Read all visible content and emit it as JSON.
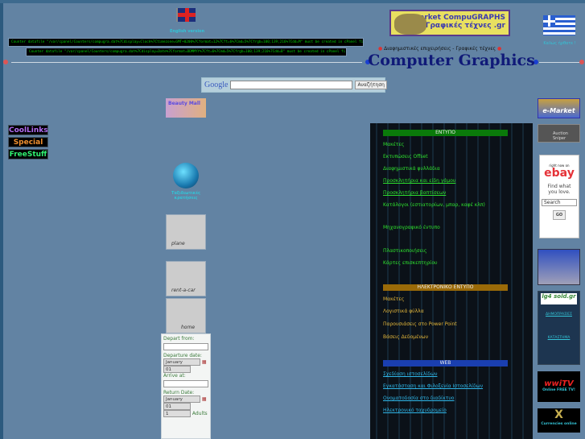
{
  "header": {
    "english_version": "English version",
    "welcome": "Καλώς ήρθατε !",
    "logo_text": "e-market CompuGRAPHS Γραφικές τέχνες .gr",
    "subtitle": "Διαφημιστικές επιχειρήσεις - Γραφικές τέχνες",
    "title": "Computer Graphics"
  },
  "counters": [
    "Counter datafile \"/var/cpanel/Counters/compugra.dat%7Cdisplay=Clock%7Ctimezone=GMT+0200%7Cformat=12%7Cft=6%7Cmd=5%7Cfrgb=100;139;216%7Cdd=M\" must be created in cPanel first!",
    "Counter datafile \"/var/cpanel/Counters/compugra.dat%7Cdisplay=Date%7Cformat=DDMMYY%7Cft=6%7Cmd=5%7Cfrgb=100;139;216%7Cdd=B\" must be created in cPanel first!"
  ],
  "search": {
    "logo": "Google",
    "button": "Αναζήτηση",
    "value": ""
  },
  "left_banners": [
    "CoolLinks",
    "Special",
    "FreeStuff"
  ],
  "middle": {
    "beauty_banner": "Beauty Mall",
    "travel_label": "Ταξιδιωτικές κρατήσεις",
    "plane": "plane",
    "rent": "rent-a-car",
    "home": "home"
  },
  "flight_form": {
    "depart_from": "Depart from:",
    "departure_date": "Departure date:",
    "month": "January",
    "day": "01",
    "arrive_at": "Arrive at:",
    "return_date": "Return Date:",
    "adults_value": "1",
    "adults": "Adults"
  },
  "sections": [
    {
      "title": "ΕΝΤΥΠΟ",
      "color": "#0a7a0a",
      "items": [
        "Μακέτες",
        "Εκτυπώσεις Offset",
        "Διαφημιστικά φυλλάδια",
        "Προσκλητήρια και είδη γάμου",
        "Προσκλητήρια βαπτίσεων",
        "Κατάλογοι (εστιατορίων, μπαρ, καφέ κλπ)",
        "Μηχανογραφικό έντυπο",
        "Πλαστικοποιήσεις",
        "Κάρτες επισκεπτηρίου"
      ]
    },
    {
      "title": "ΗΛΕΚΤΡΟΝΙΚΟ ΕΝΤΥΠΟ",
      "color": "#9a6a08",
      "items": [
        "Μακέτες",
        "Λογιστικά φύλλα",
        "Παρουσιάσεις στο Power Point",
        "Βάσεις Δεδομένων"
      ]
    },
    {
      "title": "WEB",
      "color": "#1a3fb0",
      "items": [
        "Σχεδίαση ιστοσελίδων",
        "Εγκατάσταση και Φιλοξενία Ιστοσελίδων",
        "Ονοματοδοσία στο διαδίκτυο",
        "Ηλεκτρονικό ταχυδρομείο"
      ]
    }
  ],
  "right": {
    "emarket": "e-Market",
    "auction": "Auction Sniper",
    "ebay_top": "right now on",
    "ebay_logo": "ebay",
    "ebay_text": "Find what you love.",
    "ebay_search": "Search",
    "ebay_go": "GO",
    "gr_logo": "lg4 sold.gr",
    "link1": "ΔΗΜΟΠΡΑΣΙΕΣ",
    "link2": "ΚΑΤΑΣΤΗΜΑ",
    "wwitv": "wwiTV",
    "wwitv_sub": "Online FREE TV!",
    "currencies": "Currencies online"
  }
}
